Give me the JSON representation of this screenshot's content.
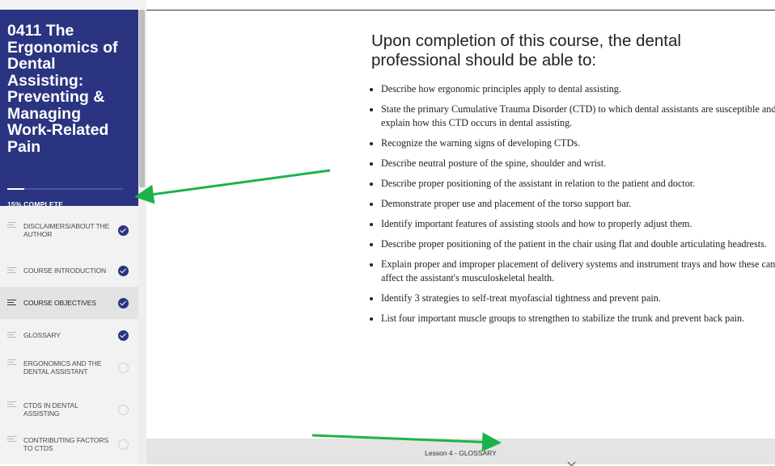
{
  "course": {
    "title": "0411 The Ergonomics of Dental Assisting: Preventing & Managing Work-Related Pain",
    "progress_label": "15% COMPLETE",
    "progress_fraction": 0.15
  },
  "lessons": [
    {
      "label": "DISCLAIMERS/ABOUT THE AUTHOR",
      "complete": true,
      "active": false
    },
    {
      "label": "COURSE INTRODUCTION",
      "complete": true,
      "active": false
    },
    {
      "label": "COURSE OBJECTIVES",
      "complete": true,
      "active": true
    },
    {
      "label": "GLOSSARY",
      "complete": true,
      "active": false
    },
    {
      "label": "ERGONOMICS AND THE DENTAL ASSISTANT",
      "complete": false,
      "active": false
    },
    {
      "label": "CTDS IN DENTAL ASSISTING",
      "complete": false,
      "active": false
    },
    {
      "label": "CONTRIBUTING FACTORS TO CTDS",
      "complete": false,
      "active": false
    }
  ],
  "main": {
    "heading": "Upon completion of this course, the dental professional should be able to:",
    "objectives": [
      "Describe how ergonomic principles apply to dental assisting.",
      "State the primary Cumulative Trauma Disorder (CTD) to which dental assistants are susceptible and explain how this CTD occurs in dental assisting.",
      "Recognize the warning signs of developing CTDs.",
      "Describe neutral posture of the spine, shoulder and wrist.",
      "Describe proper positioning of the assistant in relation to the patient and doctor.",
      "Demonstrate proper use and placement of the torso support bar.",
      "Identify important features of assisting stools and how to properly adjust them.",
      "Describe proper positioning of the patient in the chair using flat and double articulating headrests.",
      "Explain proper and improper placement of delivery systems and instrument trays and how these can affect the assistant's musculoskeletal health.",
      "Identify 3 strategies to self-treat myofascial tightness and prevent pain.",
      "List four important muscle groups to strengthen to stabilize the trunk and prevent back pain."
    ]
  },
  "footer": {
    "next_lesson_label": "Lesson 4 - GLOSSARY",
    "icon": "chevron-down-icon"
  },
  "colors": {
    "sidebar_header": "#2b3480",
    "check_complete": "#2b3480",
    "annotation_arrow": "#1db34a"
  }
}
